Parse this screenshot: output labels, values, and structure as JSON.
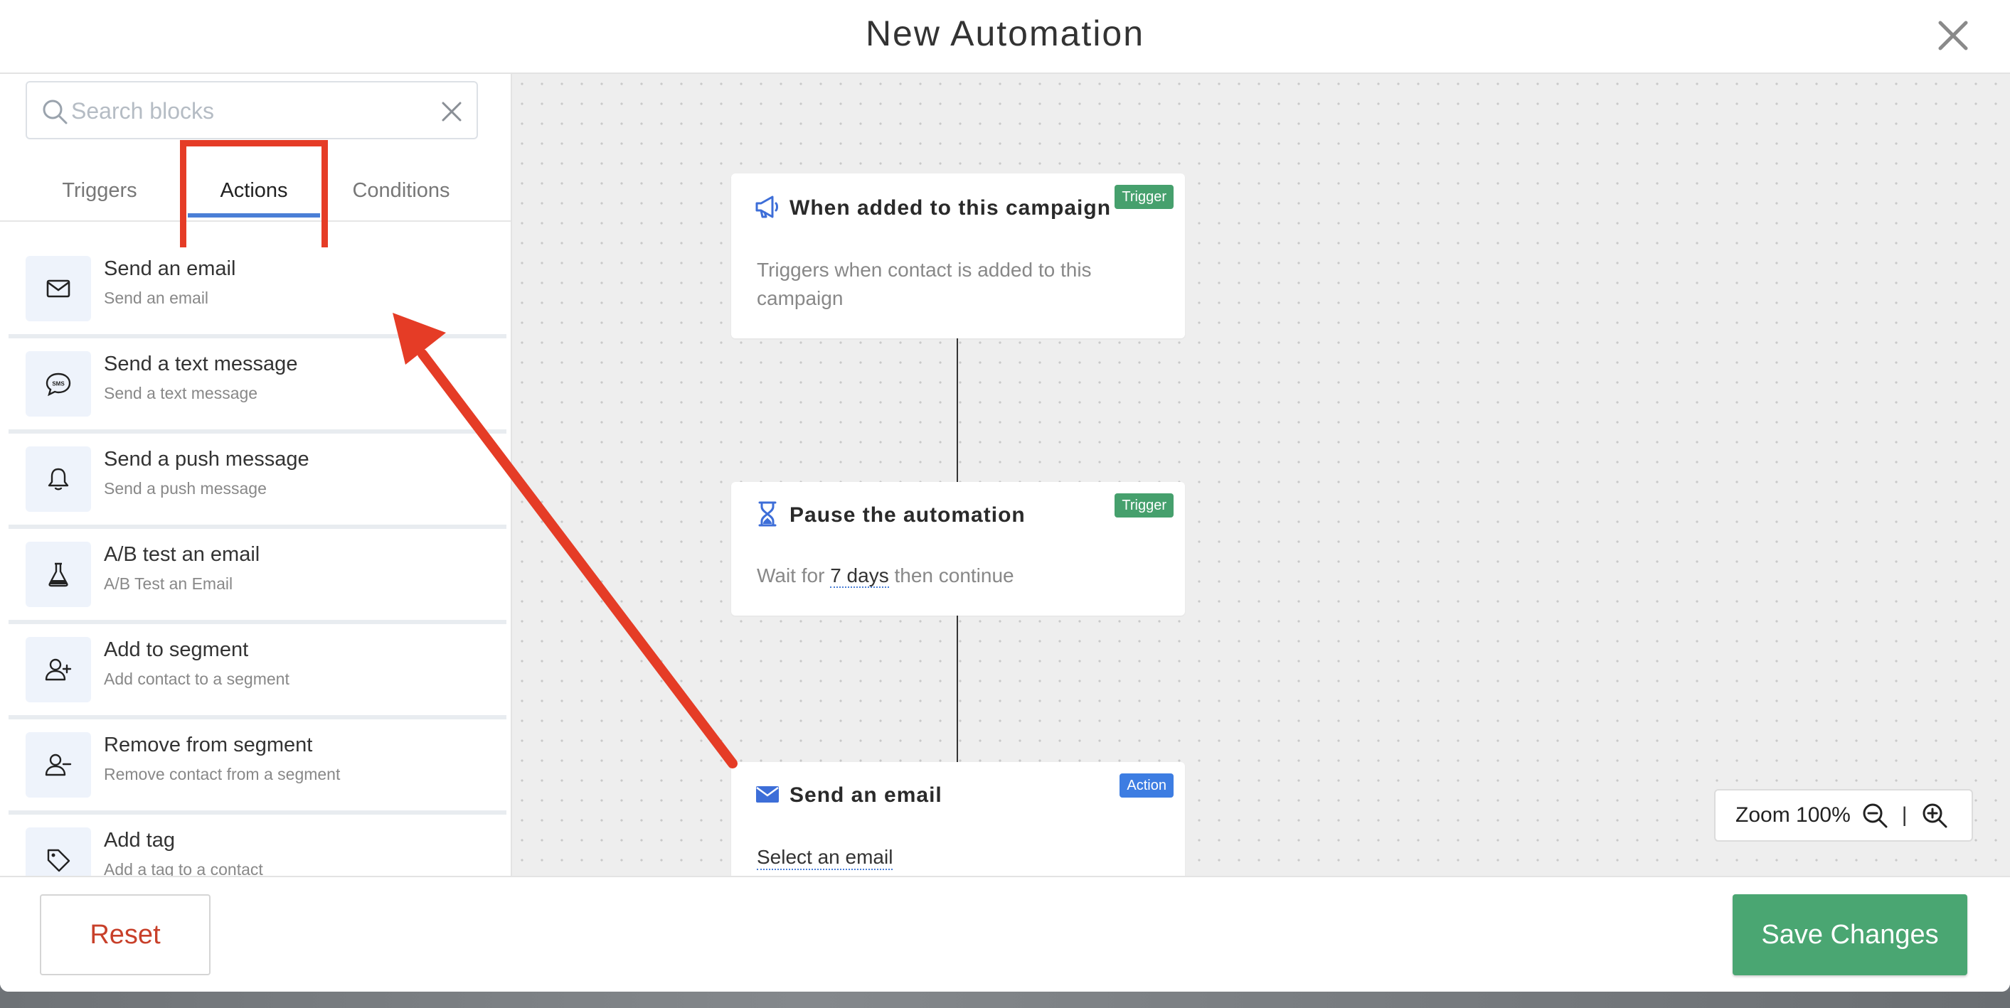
{
  "header": {
    "title": "New Automation"
  },
  "search": {
    "placeholder": "Search blocks",
    "value": ""
  },
  "tabs": [
    {
      "label": "Triggers",
      "active": false
    },
    {
      "label": "Actions",
      "active": true
    },
    {
      "label": "Conditions",
      "active": false
    }
  ],
  "blocks": [
    {
      "title": "Send an email",
      "subtitle": "Send an email",
      "icon": "envelope-icon"
    },
    {
      "title": "Send a text message",
      "subtitle": "Send a text message",
      "icon": "sms-icon"
    },
    {
      "title": "Send a push message",
      "subtitle": "Send a push message",
      "icon": "bell-icon"
    },
    {
      "title": "A/B test an email",
      "subtitle": "A/B Test an Email",
      "icon": "flask-icon"
    },
    {
      "title": "Add to segment",
      "subtitle": "Add contact to a segment",
      "icon": "user-plus-icon"
    },
    {
      "title": "Remove from segment",
      "subtitle": "Remove contact from a segment",
      "icon": "user-minus-icon"
    },
    {
      "title": "Add tag",
      "subtitle": "Add a tag to a contact",
      "icon": "tag-icon"
    }
  ],
  "canvas": {
    "cards": [
      {
        "title": "When added to this campaign",
        "badge": "Trigger",
        "description": "Triggers when contact is added to this campaign",
        "icon": "megaphone-icon"
      },
      {
        "title": "Pause the automation",
        "badge": "Trigger",
        "description_prefix": "Wait for",
        "description_value": "7 days",
        "description_suffix": "then continue",
        "icon": "hourglass-icon"
      },
      {
        "title": "Send an email",
        "badge": "Action",
        "link": "Select an email",
        "icon": "envelope-icon"
      }
    ],
    "zoom": {
      "label": "Zoom 100%",
      "separator": "|"
    }
  },
  "footer": {
    "reset_label": "Reset",
    "save_label": "Save Changes"
  },
  "colors": {
    "accent": "#4a7fd6",
    "trigger_badge": "#46a06d",
    "action_badge": "#3d7de2",
    "save_button": "#4aa672",
    "reset_text": "#c8402a",
    "annotation_red": "#e53c26"
  }
}
